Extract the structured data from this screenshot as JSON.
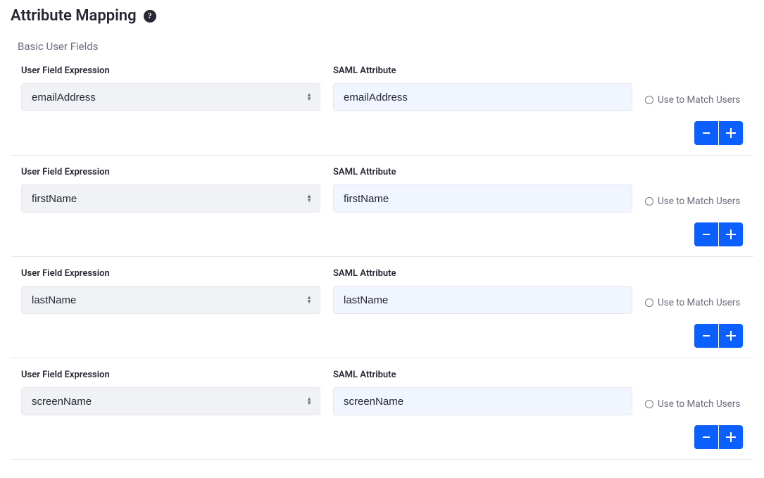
{
  "header": {
    "title": "Attribute Mapping",
    "help_glyph": "?"
  },
  "section": {
    "label": "Basic User Fields"
  },
  "labels": {
    "user_field_expression": "User Field Expression",
    "saml_attribute": "SAML Attribute",
    "use_to_match": "Use to Match Users"
  },
  "buttons": {
    "remove_title": "Remove row",
    "add_title": "Add row"
  },
  "rows": [
    {
      "ufe": "emailAddress",
      "saml": "emailAddress",
      "match": false
    },
    {
      "ufe": "firstName",
      "saml": "firstName",
      "match": false
    },
    {
      "ufe": "lastName",
      "saml": "lastName",
      "match": false
    },
    {
      "ufe": "screenName",
      "saml": "screenName",
      "match": false
    }
  ]
}
